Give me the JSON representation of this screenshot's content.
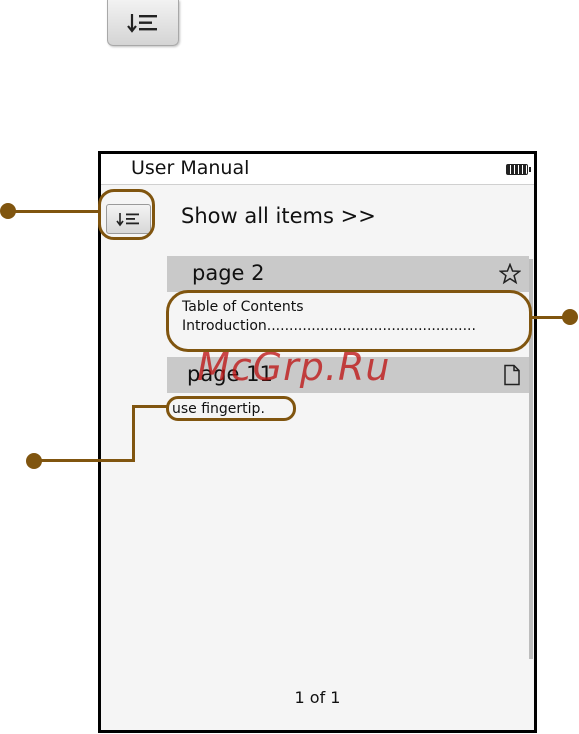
{
  "top_button": {
    "icon": "sort-list-icon"
  },
  "device": {
    "title": "User Manual",
    "battery_icon": "battery-icon",
    "show_all": "Show all items >>",
    "sections": [
      {
        "heading": "page 2",
        "icon": "star-icon",
        "lines": [
          "Table of Contents",
          "Introduction..............................................."
        ]
      },
      {
        "heading": "page 11",
        "icon": "document-icon",
        "lines": [
          "use fingertip."
        ]
      }
    ],
    "page_indicator": "1 of 1"
  },
  "watermark": "McGrp.Ru",
  "colors": {
    "callout": "#80550f",
    "header_bg": "#c9c9c9",
    "watermark": "#be1414"
  }
}
